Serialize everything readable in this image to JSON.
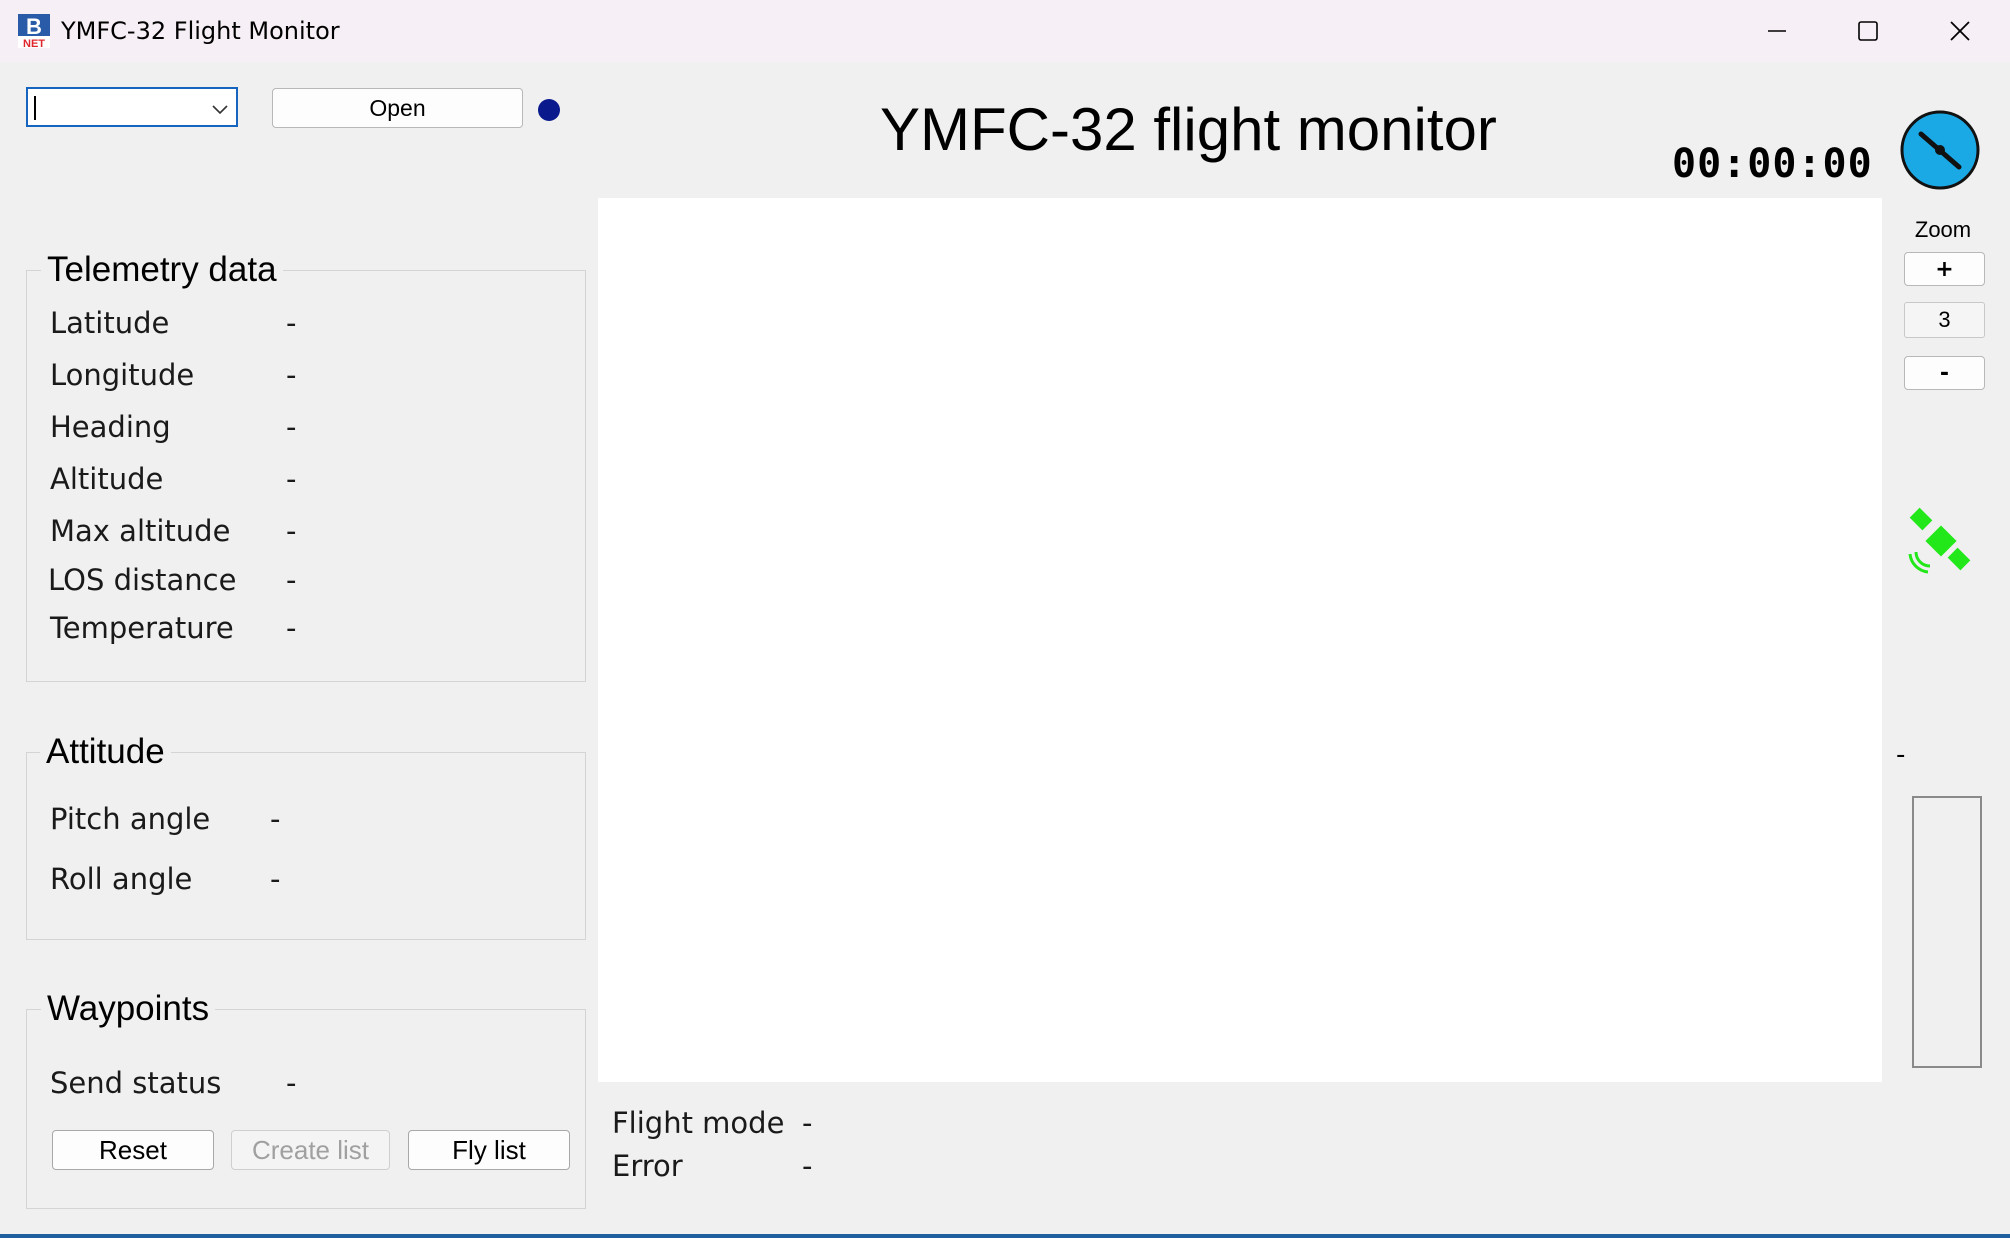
{
  "window": {
    "title": "YMFC-32 Flight Monitor",
    "icon_text_top": "B",
    "icon_text_bottom": "NET"
  },
  "toolbar": {
    "port_select_value": "",
    "open_label": "Open",
    "status_led_color": "#0a1a8c"
  },
  "header": {
    "title": "YMFC-32 flight monitor",
    "timer": "00:00:00"
  },
  "telemetry": {
    "title": "Telemetry data",
    "rows": [
      {
        "label": "Latitude",
        "value": "-"
      },
      {
        "label": "Longitude",
        "value": "-"
      },
      {
        "label": "Heading",
        "value": "-"
      },
      {
        "label": "Altitude",
        "value": "-"
      },
      {
        "label": "Max altitude",
        "value": "-"
      },
      {
        "label": "LOS distance",
        "value": "-"
      },
      {
        "label": "Temperature",
        "value": "-"
      }
    ]
  },
  "attitude": {
    "title": "Attitude",
    "rows": [
      {
        "label": "Pitch angle",
        "value": "-"
      },
      {
        "label": "Roll angle",
        "value": "-"
      }
    ]
  },
  "waypoints": {
    "title": "Waypoints",
    "send_status_label": "Send status",
    "send_status_value": "-",
    "reset_label": "Reset",
    "create_list_label": "Create list",
    "fly_list_label": "Fly list"
  },
  "status": {
    "flight_mode_label": "Flight mode",
    "flight_mode_value": "-",
    "error_label": "Error",
    "error_value": "-"
  },
  "zoom": {
    "label": "Zoom",
    "plus_label": "+",
    "value": "3",
    "minus_label": "-"
  },
  "altitude_bar": {
    "label": "-"
  },
  "colors": {
    "heading_indicator": "#1ba9e6",
    "satellite_icon": "#22e81a",
    "map_background": "#ffffff"
  }
}
